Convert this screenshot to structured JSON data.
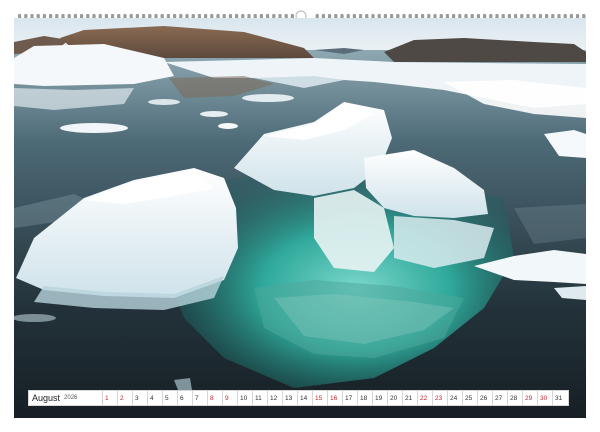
{
  "calendar": {
    "month": "August",
    "year": "2026",
    "days": [
      {
        "n": "1",
        "weekend": true
      },
      {
        "n": "2",
        "weekend": true
      },
      {
        "n": "3",
        "weekend": false
      },
      {
        "n": "4",
        "weekend": false
      },
      {
        "n": "5",
        "weekend": false
      },
      {
        "n": "6",
        "weekend": false
      },
      {
        "n": "7",
        "weekend": false
      },
      {
        "n": "8",
        "weekend": true
      },
      {
        "n": "9",
        "weekend": true
      },
      {
        "n": "10",
        "weekend": false
      },
      {
        "n": "11",
        "weekend": false
      },
      {
        "n": "12",
        "weekend": false
      },
      {
        "n": "13",
        "weekend": false
      },
      {
        "n": "14",
        "weekend": false
      },
      {
        "n": "15",
        "weekend": true
      },
      {
        "n": "16",
        "weekend": true
      },
      {
        "n": "17",
        "weekend": false
      },
      {
        "n": "18",
        "weekend": false
      },
      {
        "n": "19",
        "weekend": false
      },
      {
        "n": "20",
        "weekend": false
      },
      {
        "n": "21",
        "weekend": false
      },
      {
        "n": "22",
        "weekend": true
      },
      {
        "n": "23",
        "weekend": true
      },
      {
        "n": "24",
        "weekend": false
      },
      {
        "n": "25",
        "weekend": false
      },
      {
        "n": "26",
        "weekend": false
      },
      {
        "n": "27",
        "weekend": false
      },
      {
        "n": "28",
        "weekend": false
      },
      {
        "n": "29",
        "weekend": true
      },
      {
        "n": "30",
        "weekend": true
      },
      {
        "n": "31",
        "weekend": false
      }
    ]
  },
  "colors": {
    "weekend": "#c0262c",
    "weekday": "#333333",
    "water": "#2c4452",
    "ice": "#f3f7f8",
    "glacier_turquoise": "#3fb7ad"
  }
}
